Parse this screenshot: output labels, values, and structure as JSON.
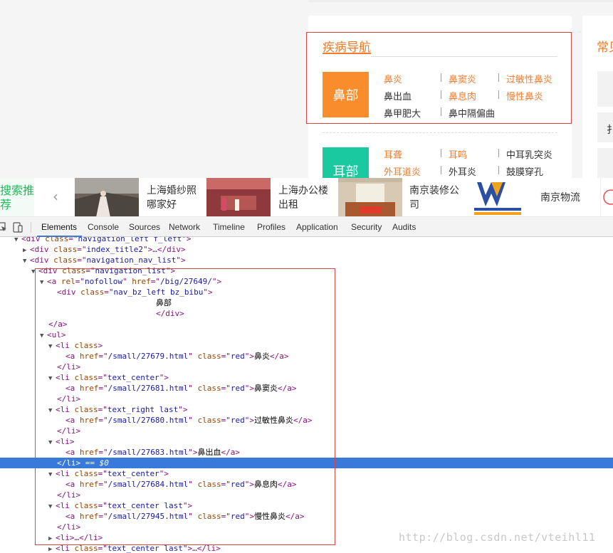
{
  "page": {
    "disease_nav_title": "疾病导航",
    "right_card_title": "常见",
    "right_box_letter": "扌",
    "categories": [
      {
        "name": "鼻部",
        "color": "#f98d2b",
        "links": [
          "鼻炎",
          "鼻窦炎",
          "过敏性鼻炎",
          "鼻出血",
          "鼻息肉",
          "慢性鼻炎",
          "鼻甲肥大",
          "鼻中隔偏曲"
        ]
      },
      {
        "name": "耳部",
        "color": "#1bc9a0",
        "links": [
          "耳聋",
          "耳鸣",
          "中耳乳突炎",
          "外耳道炎",
          "外耳炎",
          "鼓膜穿孔"
        ]
      }
    ]
  },
  "ads": {
    "search_label": "搜索推荐",
    "prev_arrow": "‹",
    "items": [
      {
        "text": "上海婚纱照哪家好"
      },
      {
        "text": "上海办公楼出租"
      },
      {
        "text": "南京装修公司"
      },
      {
        "text": "南京物流"
      }
    ]
  },
  "devtools": {
    "tabs": [
      "Elements",
      "Console",
      "Sources",
      "Network",
      "Timeline",
      "Profiles",
      "Application",
      "Security",
      "Audits"
    ],
    "active_tab": "Elements",
    "selected_marker": "== $0",
    "nav_bz_text": "鼻部",
    "hrefs": {
      "big": "/big/27649/",
      "h1": "/small/27679.html",
      "h2": "/small/27681.html",
      "h3": "/small/27680.html",
      "h4": "/small/27683.html",
      "h5": "/small/27684.html",
      "h6": "/small/27945.html"
    },
    "classes": {
      "nav_left": "navigation_left f_left",
      "index_title": "index_title2",
      "nav_list_wrap": "navigation_nav_list",
      "nav_list": "navigation_list",
      "nav_bz": "nav_bz_left bz_bibu",
      "red": "red",
      "center": "text_center",
      "right_last": "text_right last",
      "center_last": "text_center last"
    },
    "link_texts": [
      "鼻炎",
      "鼻窦炎",
      "过敏性鼻炎",
      "鼻出血",
      "鼻息肉",
      "慢性鼻炎"
    ]
  },
  "watermark": "http://blog.csdn.net/vteihl11"
}
